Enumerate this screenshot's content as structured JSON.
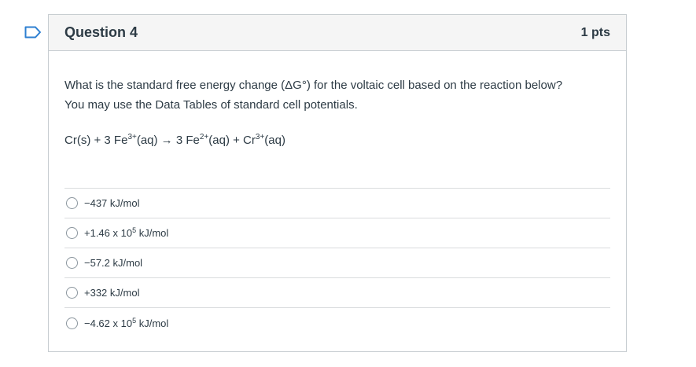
{
  "question": {
    "title": "Question 4",
    "points": "1 pts",
    "prompt_line1": "What is the standard free energy change (ΔG°) for the voltaic cell based on the reaction below?",
    "prompt_line2": "You may use the Data Tables of standard cell potentials.",
    "reaction": {
      "part1": "Cr(s) +  3 Fe",
      "sup1": "3+",
      "part2": "(aq) → 3 Fe",
      "sup2": "2+",
      "part3": "(aq) + Cr",
      "sup3": "3+",
      "part4": "(aq)"
    }
  },
  "answers": [
    {
      "base": "−437 kJ/mol",
      "sup": "",
      "rest": ""
    },
    {
      "base": "+1.46 x 10",
      "sup": "5",
      "rest": " kJ/mol"
    },
    {
      "base": "−57.2 kJ/mol",
      "sup": "",
      "rest": ""
    },
    {
      "base": "+332 kJ/mol",
      "sup": "",
      "rest": ""
    },
    {
      "base": "−4.62 x 10",
      "sup": "5",
      "rest": " kJ/mol"
    }
  ],
  "icons": {
    "flag": "bookmark-flag-icon",
    "flag_color": "#2d7fd1"
  }
}
